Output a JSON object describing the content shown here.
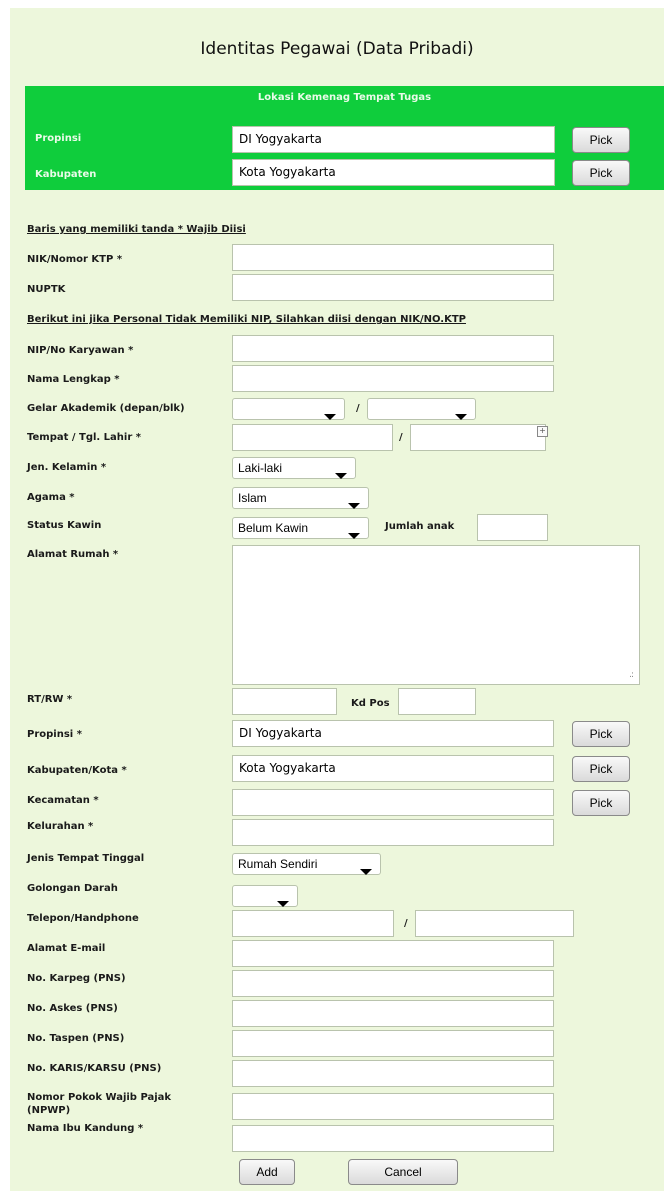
{
  "title": "Identitas Pegawai (Data Pribadi)",
  "location": {
    "header": "Lokasi Kemenag Tempat Tugas",
    "province_label": "Propinsi",
    "province_value": "DI Yogyakarta",
    "regency_label": "Kabupaten",
    "regency_value": "Kota Yogyakarta",
    "pick_label": "Pick"
  },
  "form": {
    "required_note": "Baris yang memiliki tanda * Wajib Diisi",
    "nip_note": "Berikut ini jika Personal Tidak Memiliki NIP, Silahkan diisi dengan NIK/NO.KTP",
    "nik_label": "NIK/Nomor KTP *",
    "nuptk_label": "NUPTK",
    "nip_label": "NIP/No Karyawan *",
    "fullname_label": "Nama Lengkap *",
    "degree_label": "Gelar Akademik (depan/blk)",
    "birth_label": "Tempat / Tgl. Lahir *",
    "gender_label": "Jen. Kelamin *",
    "gender_value": "Laki-laki",
    "religion_label": "Agama *",
    "religion_value": "Islam",
    "marital_label": "Status Kawin",
    "marital_value": "Belum Kawin",
    "children_label": "Jumlah anak",
    "address_label": "Alamat Rumah *",
    "rtrw_label": "RT/RW *",
    "postal_label": "Kd Pos",
    "province_label": "Propinsi *",
    "province_value": "DI Yogyakarta",
    "regency_label": "Kabupaten/Kota *",
    "regency_value": "Kota Yogyakarta",
    "district_label": "Kecamatan *",
    "village_label": "Kelurahan *",
    "residence_label": "Jenis Tempat Tinggal",
    "residence_value": "Rumah Sendiri",
    "blood_label": "Golongan Darah",
    "phone_label": "Telepon/Handphone",
    "email_label": "Alamat E-mail",
    "karpeg_label": "No. Karpeg (PNS)",
    "askes_label": "No. Askes (PNS)",
    "taspen_label": "No. Taspen (PNS)",
    "karis_label": "No. KARIS/KARSU (PNS)",
    "npwp_label_1": "Nomor Pokok Wajib Pajak",
    "npwp_label_2": "(NPWP)",
    "mother_label": "Nama Ibu Kandung *",
    "slash": "/",
    "pick_label": "Pick"
  },
  "buttons": {
    "add": "Add",
    "cancel": "Cancel"
  }
}
